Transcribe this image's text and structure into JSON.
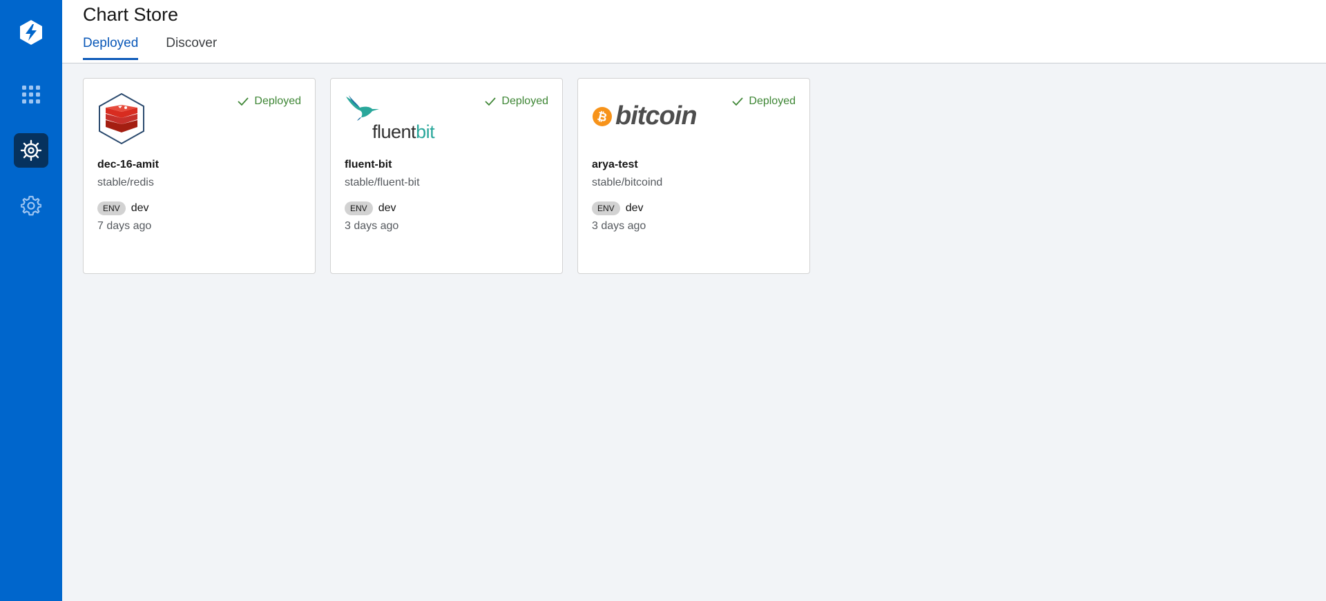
{
  "app": {
    "logo_icon": "devtron-logo-icon",
    "brand_color": "#0066cc"
  },
  "sidebar": {
    "items": [
      {
        "name": "applications",
        "icon": "grid-icon",
        "active": false
      },
      {
        "name": "chart-store",
        "icon": "helm-wheel-icon",
        "active": true
      },
      {
        "name": "global-configurations",
        "icon": "gear-icon",
        "active": false
      }
    ]
  },
  "header": {
    "title": "Chart Store",
    "tabs": [
      {
        "label": "Deployed",
        "active": true
      },
      {
        "label": "Discover",
        "active": false
      }
    ]
  },
  "cards": [
    {
      "logo_icon": "redis-icon",
      "status": "Deployed",
      "release_name": "dec-16-amit",
      "chart": "stable/redis",
      "env_badge": "ENV",
      "env": "dev",
      "age": "7 days ago"
    },
    {
      "logo_icon": "fluentbit-logo",
      "logo_text_a": "fluent",
      "logo_text_b": "bit",
      "status": "Deployed",
      "release_name": "fluent-bit",
      "chart": "stable/fluent-bit",
      "env_badge": "ENV",
      "env": "dev",
      "age": "3 days ago"
    },
    {
      "logo_icon": "bitcoin-logo",
      "logo_text": "bitcoin",
      "status": "Deployed",
      "release_name": "arya-test",
      "chart": "stable/bitcoind",
      "env_badge": "ENV",
      "env": "dev",
      "age": "3 days ago"
    }
  ]
}
